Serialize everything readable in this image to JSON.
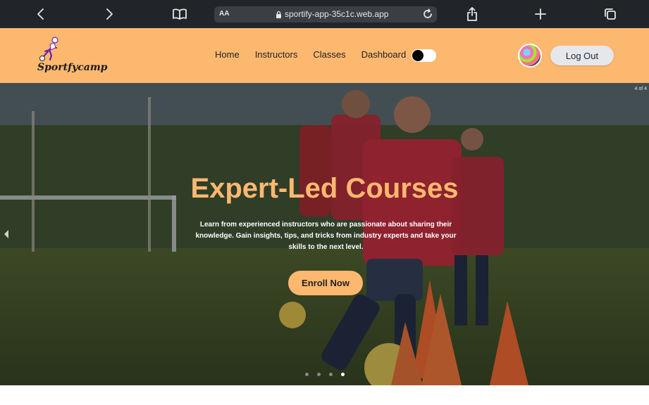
{
  "browser": {
    "text_size_label": "AA",
    "url": "sportify-app-35c1c.web.app"
  },
  "navbar": {
    "brand": "Sportfycamp",
    "links": [
      "Home",
      "Instructors",
      "Classes",
      "Dashboard"
    ],
    "theme_toggle_on": false,
    "logout_label": "Log Out",
    "background_color": "#fdb870"
  },
  "hero": {
    "slide_counter": "4 of 4",
    "title": "Expert-Led Courses",
    "description": "Learn from experienced instructors who are passionate about sharing their knowledge. Gain insights, tips, and tricks from industry experts and take your skills to the next level.",
    "cta_label": "Enroll Now",
    "accent_color": "#fdb870",
    "dots_total": 4,
    "active_dot": 4
  }
}
